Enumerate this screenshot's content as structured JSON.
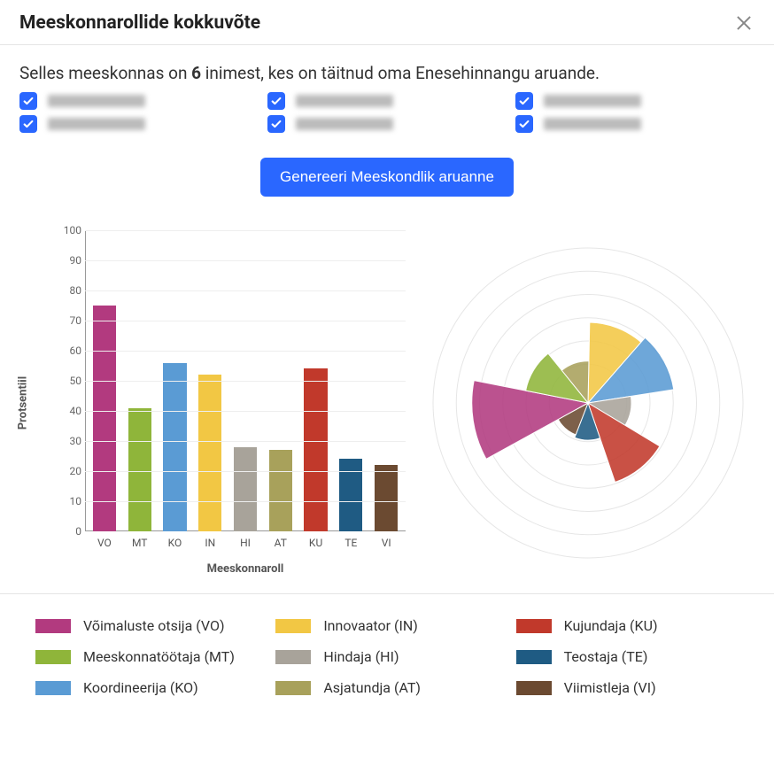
{
  "title": "Meeskonnarollide kokkuvõte",
  "sentence": {
    "pre": "Selles meeskonnas on ",
    "count": "6",
    "post": " inimest, kes on täitnud oma Enesehinnangu aruande."
  },
  "people": [
    {
      "checked": true
    },
    {
      "checked": true
    },
    {
      "checked": true
    },
    {
      "checked": true
    },
    {
      "checked": true
    },
    {
      "checked": true
    }
  ],
  "button": "Genereeri Meeskondlik aruanne",
  "axis": {
    "y_label": "Protsentiil",
    "x_label": "Meeskonnaroll"
  },
  "y_ticks": [
    0,
    10,
    20,
    30,
    40,
    50,
    60,
    70,
    80,
    90,
    100
  ],
  "roles": [
    {
      "code": "VO",
      "name": "Võimaluste otsija",
      "legend": "Võimaluste otsija (VO)",
      "color": "#b23a7f",
      "value": 75
    },
    {
      "code": "MT",
      "name": "Meeskonnatöötaja",
      "legend": "Meeskonnatöötaja (MT)",
      "color": "#8fb53a",
      "value": 41
    },
    {
      "code": "KO",
      "name": "Koordineerija",
      "legend": "Koordineerija (KO)",
      "color": "#5a9bd4",
      "value": 56
    },
    {
      "code": "IN",
      "name": "Innovaator",
      "legend": "Innovaator (IN)",
      "color": "#f2c744",
      "value": 52
    },
    {
      "code": "HI",
      "name": "Hindaja",
      "legend": "Hindaja (HI)",
      "color": "#a8a39a",
      "value": 28
    },
    {
      "code": "AT",
      "name": "Asjatundja",
      "legend": "Asjatundja (AT)",
      "color": "#a8a15b",
      "value": 27
    },
    {
      "code": "KU",
      "name": "Kujundaja",
      "legend": "Kujundaja (KU)",
      "color": "#c1392b",
      "value": 54
    },
    {
      "code": "TE",
      "name": "Teostaja",
      "legend": "Teostaja (TE)",
      "color": "#1f5b83",
      "value": 24
    },
    {
      "code": "VI",
      "name": "Viimistleja",
      "legend": "Viimistleja (VI)",
      "color": "#6b4a31",
      "value": 22
    }
  ],
  "chart_data": {
    "type": "bar",
    "title": "",
    "xlabel": "Meeskonnaroll",
    "ylabel": "Protsentiil",
    "ylim": [
      0,
      100
    ],
    "categories": [
      "VO",
      "MT",
      "KO",
      "IN",
      "HI",
      "AT",
      "KU",
      "TE",
      "VI"
    ],
    "values": [
      75,
      41,
      56,
      52,
      28,
      27,
      54,
      24,
      22
    ],
    "series": [
      {
        "name": "Võimaluste otsija (VO)",
        "color": "#b23a7f",
        "value": 75
      },
      {
        "name": "Meeskonnatöötaja (MT)",
        "color": "#8fb53a",
        "value": 41
      },
      {
        "name": "Koordineerija (KO)",
        "color": "#5a9bd4",
        "value": 56
      },
      {
        "name": "Innovaator (IN)",
        "color": "#f2c744",
        "value": 52
      },
      {
        "name": "Hindaja (HI)",
        "color": "#a8a39a",
        "value": 28
      },
      {
        "name": "Asjatundja (AT)",
        "color": "#a8a15b",
        "value": 27
      },
      {
        "name": "Kujundaja (KU)",
        "color": "#c1392b",
        "value": 54
      },
      {
        "name": "Teostaja (TE)",
        "color": "#1f5b83",
        "value": 24
      },
      {
        "name": "Viimistleja (VI)",
        "color": "#6b4a31",
        "value": 22
      }
    ],
    "secondary_chart": {
      "type": "polar-area-rose",
      "note": "Radius encodes same values as bar heights on 0–100 scale",
      "categories": [
        "VO",
        "MT",
        "KO",
        "IN",
        "HI",
        "AT",
        "KU",
        "TE",
        "VI"
      ],
      "values": [
        75,
        41,
        56,
        52,
        28,
        27,
        54,
        24,
        22
      ]
    }
  }
}
